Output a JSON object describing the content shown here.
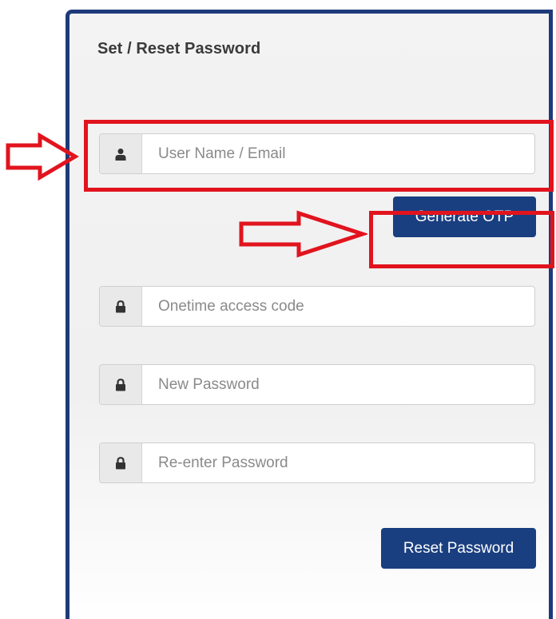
{
  "form": {
    "title": "Set / Reset Password",
    "username": {
      "value": "",
      "placeholder": "User Name / Email",
      "icon": "user-icon"
    },
    "generate_otp_label": "Generate OTP",
    "otp": {
      "value": "",
      "placeholder": "Onetime access code",
      "icon": "lock-icon"
    },
    "new_password": {
      "value": "",
      "placeholder": "New Password",
      "icon": "lock-icon"
    },
    "confirm_password": {
      "value": "",
      "placeholder": "Re-enter Password",
      "icon": "lock-icon"
    },
    "reset_label": "Reset Password"
  },
  "annotations": {
    "highlight_color": "#e1141e",
    "items": [
      "username-field-highlight",
      "generate-otp-highlight"
    ]
  },
  "colors": {
    "panel_border": "#1f3a7a",
    "button": "#1a3f80"
  }
}
